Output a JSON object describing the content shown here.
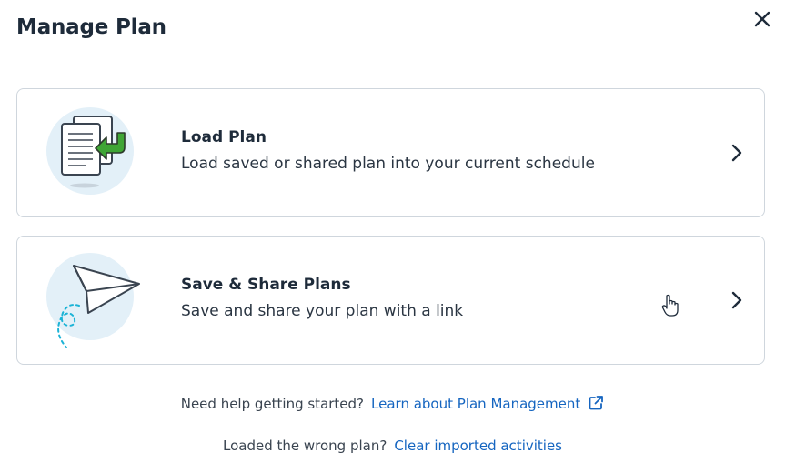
{
  "dialog": {
    "title": "Manage Plan"
  },
  "cards": [
    {
      "title": "Load Plan",
      "description": "Load saved or shared plan into your current schedule",
      "icon": "load-document-icon"
    },
    {
      "title": "Save & Share Plans",
      "description": "Save and share your plan with a link",
      "icon": "paper-plane-icon"
    }
  ],
  "footer": {
    "help_text": "Need help getting started?",
    "help_link": "Learn about Plan Management",
    "wrong_text": "Loaded the wrong plan?",
    "wrong_link": "Clear imported activities"
  },
  "colors": {
    "link": "#1565c0",
    "card_border": "#cfd6dd",
    "icon_circle": "#e3f0f8",
    "arrow_green": "#3fa535",
    "dash_cyan": "#1bb3d6"
  }
}
